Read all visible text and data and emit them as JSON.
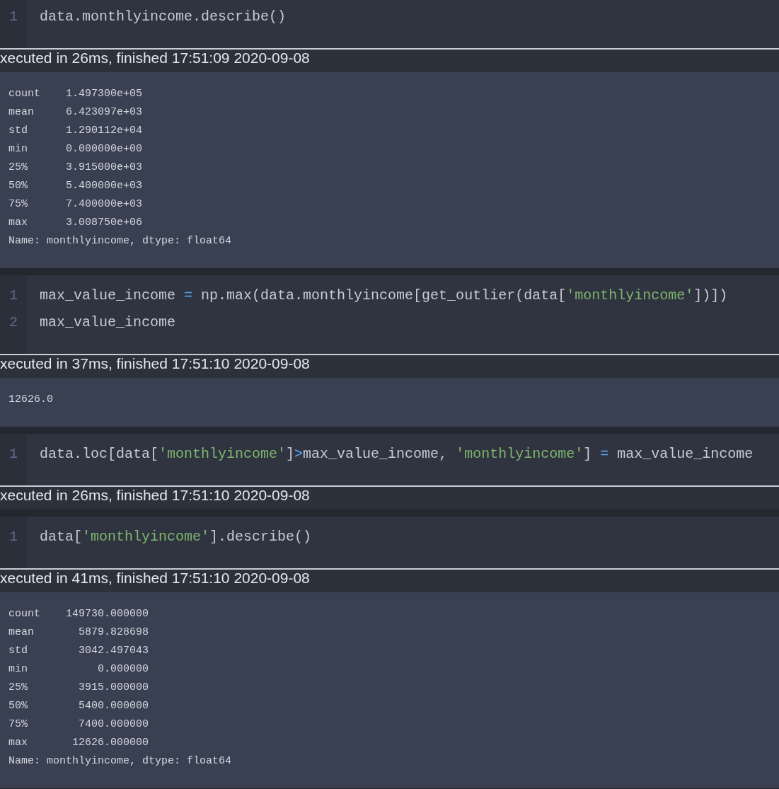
{
  "cells": [
    {
      "lines": [
        {
          "number": "1",
          "tokens": [
            {
              "kind": "plain",
              "text": "data.monthlyincome.describe()"
            }
          ]
        }
      ],
      "execution": "xecuted in 26ms, finished 17:51:09 2020-09-08",
      "output": [
        "count    1.497300e+05",
        "mean     6.423097e+03",
        "std      1.290112e+04",
        "min      0.000000e+00",
        "25%      3.915000e+03",
        "50%      5.400000e+03",
        "75%      7.400000e+03",
        "max      3.008750e+06",
        "Name: monthlyincome, dtype: float64"
      ]
    },
    {
      "lines": [
        {
          "number": "1",
          "tokens": [
            {
              "kind": "plain",
              "text": "max_value_income "
            },
            {
              "kind": "operator",
              "text": "="
            },
            {
              "kind": "plain",
              "text": " np.max(data.monthlyincome[get_outlier(data["
            },
            {
              "kind": "string",
              "text": "'monthlyincome'"
            },
            {
              "kind": "plain",
              "text": "])])"
            }
          ]
        },
        {
          "number": "2",
          "tokens": [
            {
              "kind": "plain",
              "text": "max_value_income"
            }
          ]
        }
      ],
      "execution": "xecuted in 37ms, finished 17:51:10 2020-09-08",
      "output": [
        "12626.0"
      ]
    },
    {
      "lines": [
        {
          "number": "1",
          "tokens": [
            {
              "kind": "plain",
              "text": "data.loc[data["
            },
            {
              "kind": "string",
              "text": "'monthlyincome'"
            },
            {
              "kind": "plain",
              "text": "]"
            },
            {
              "kind": "operator",
              "text": ">"
            },
            {
              "kind": "plain",
              "text": "max_value_income, "
            },
            {
              "kind": "string",
              "text": "'monthlyincome'"
            },
            {
              "kind": "plain",
              "text": "] "
            },
            {
              "kind": "operator",
              "text": "="
            },
            {
              "kind": "plain",
              "text": " max_value_income"
            }
          ]
        }
      ],
      "execution": "xecuted in 26ms, finished 17:51:10 2020-09-08"
    },
    {
      "lines": [
        {
          "number": "1",
          "tokens": [
            {
              "kind": "plain",
              "text": "data["
            },
            {
              "kind": "string",
              "text": "'monthlyincome'"
            },
            {
              "kind": "plain",
              "text": "].describe()"
            }
          ]
        }
      ],
      "execution": "xecuted in 41ms, finished 17:51:10 2020-09-08",
      "output": [
        "count    149730.000000",
        "mean       5879.828698",
        "std        3042.497043",
        "min           0.000000",
        "25%        3915.000000",
        "50%        5400.000000",
        "75%        7400.000000",
        "max       12626.000000",
        "Name: monthlyincome, dtype: float64"
      ]
    }
  ]
}
